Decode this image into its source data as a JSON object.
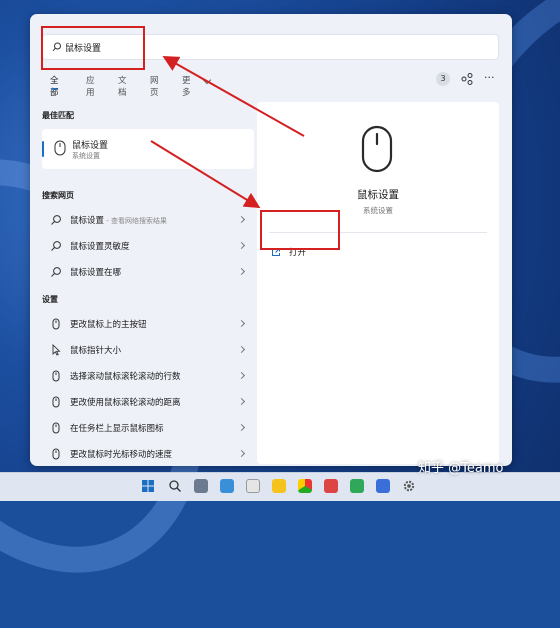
{
  "search": {
    "value": "鼠标设置"
  },
  "tabs": [
    "全部",
    "应用",
    "文档",
    "网页",
    "更多"
  ],
  "toolbar": {
    "count": "3"
  },
  "sections": {
    "best_match": "最佳匹配",
    "web": "搜索网页",
    "settings": "设置"
  },
  "best_match": {
    "title": "鼠标设置",
    "subtitle": "系统设置"
  },
  "web_results": [
    {
      "label": "鼠标设置",
      "tail": " - 查看网络搜索结果"
    },
    {
      "label": "鼠标设置灵敏度",
      "tail": ""
    },
    {
      "label": "鼠标设置在哪",
      "tail": ""
    }
  ],
  "settings_results": [
    "更改鼠标上的主按钮",
    "鼠标指针大小",
    "选择滚动鼠标滚轮滚动的行数",
    "更改使用鼠标滚轮滚动的距离",
    "在任务栏上显示鼠标图标",
    "更改鼠标时光标移动的速度"
  ],
  "detail": {
    "title": "鼠标设置",
    "subtitle": "系统设置",
    "open_label": "打开"
  },
  "watermark": "知乎 @Teamo",
  "colors": {
    "accent": "#1b6ec2",
    "annotation": "#d42020"
  },
  "taskbar_icons": [
    "windows-start-icon",
    "search-icon",
    "taskview-icon",
    "widgets-icon",
    "chat-icon",
    "chrome-icon",
    "folder-icon",
    "photos-icon",
    "edge-icon",
    "store-icon",
    "settings-icon",
    "gear-icon"
  ]
}
